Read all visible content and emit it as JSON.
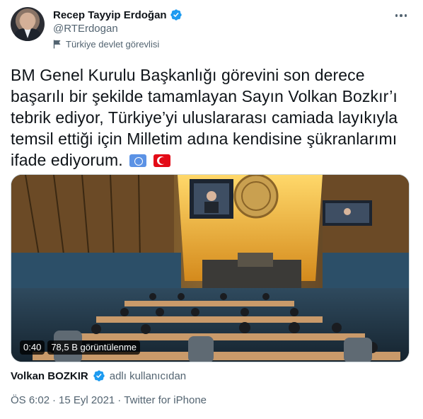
{
  "author": {
    "display_name": "Recep Tayyip Erdoğan",
    "handle": "@RTErdogan",
    "label": "Türkiye devlet görevlisi",
    "verified_icon": "verified-badge-icon",
    "label_icon": "flag-icon"
  },
  "tweet": {
    "text": "BM Genel Kurulu Başkanlığı görevini son derece başarılı bir şekilde tamamlayan Sayın Volkan Bozkır’ı tebrik ediyor, Türkiye’yi uluslararası camiada layıkıyla temsil ettiği için Milletim adına kendisine şükranlarımı ifade ediyorum.",
    "emojis": [
      "un-flag-emoji",
      "turkey-flag-emoji"
    ]
  },
  "video": {
    "duration": "0:40",
    "views": "78,5 B görüntülenme"
  },
  "attribution": {
    "name": "Volkan BOZKIR",
    "suffix": "adlı kullanıcıdan"
  },
  "meta": {
    "time": "ÖS 6:02",
    "separator": "·",
    "date": "15 Eyl 2021",
    "source": "Twitter for iPhone"
  },
  "colors": {
    "text_primary": "#0f1419",
    "text_secondary": "#536471",
    "verified_blue": "#1d9bf0"
  }
}
